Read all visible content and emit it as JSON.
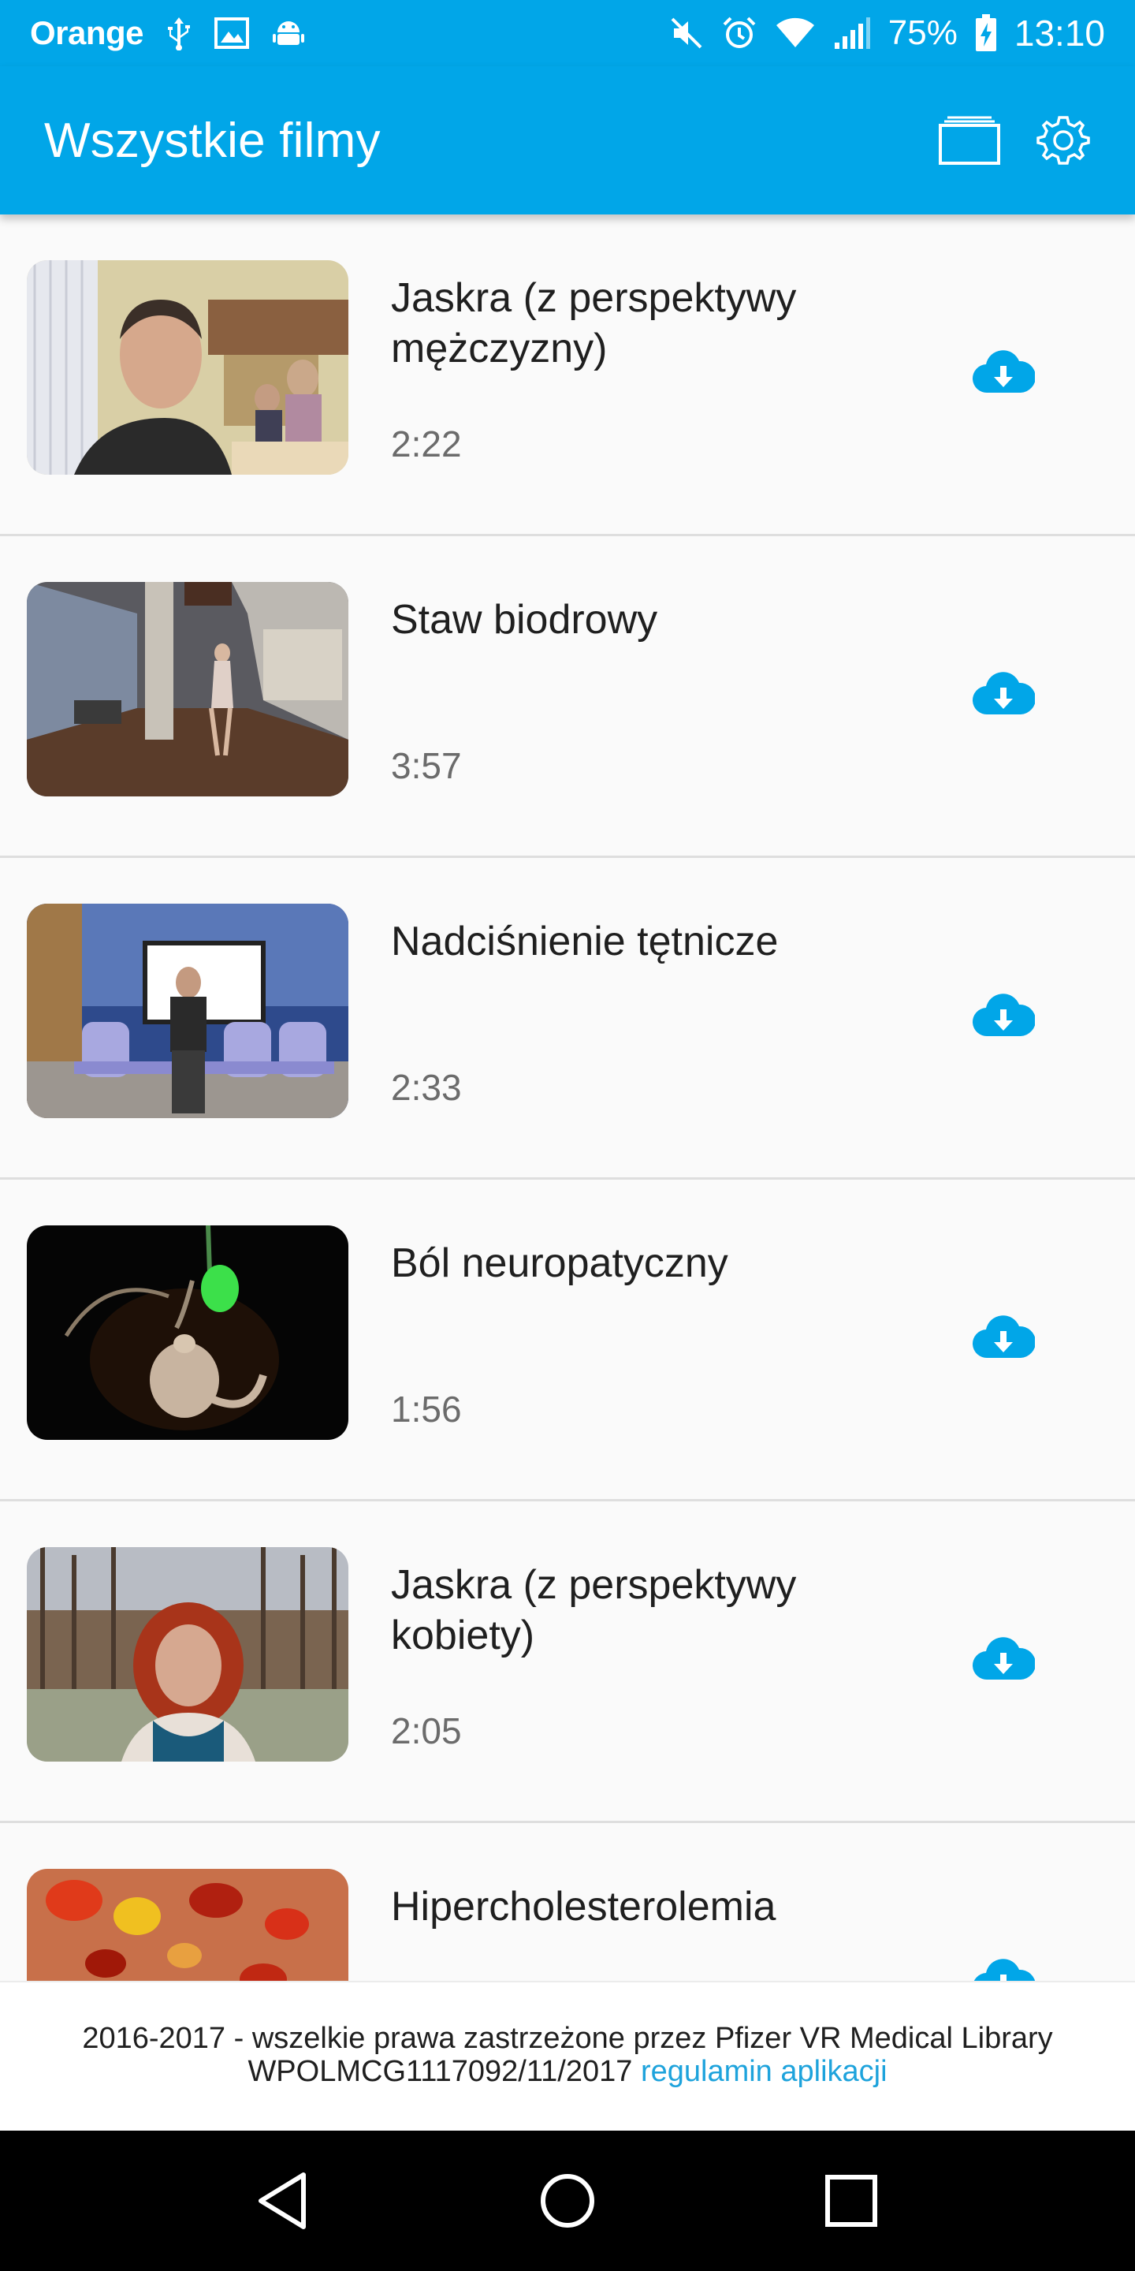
{
  "status_bar": {
    "carrier": "Orange",
    "battery": "75%",
    "time": "13:10",
    "icons": [
      "usb-icon",
      "image-icon",
      "android-icon",
      "mute-icon",
      "alarm-icon",
      "wifi-icon",
      "signal-icon",
      "battery-charging-icon"
    ]
  },
  "app_bar": {
    "title": "Wszystkie filmy",
    "actions": [
      "cardboard-viewer-icon",
      "settings-gear-icon"
    ]
  },
  "colors": {
    "primary": "#01a6e8",
    "link": "#1ea3dc",
    "download_icon": "#01a6e8"
  },
  "videos": [
    {
      "title": "Jaskra (z perspektywy mężczyzny)",
      "duration": "2:22",
      "thumbnail": "man-at-dinner-table",
      "action_icon": "cloud-download-icon"
    },
    {
      "title": "Staw biodrowy",
      "duration": "3:57",
      "thumbnail": "dancer-in-studio",
      "action_icon": "cloud-download-icon"
    },
    {
      "title": "Nadciśnienie tętnicze",
      "duration": "2:33",
      "thumbnail": "man-in-waiting-room",
      "action_icon": "cloud-download-icon"
    },
    {
      "title": "Ból neuropatyczny",
      "duration": "1:56",
      "thumbnail": "neuron-illustration",
      "action_icon": "cloud-download-icon"
    },
    {
      "title": "Jaskra (z perspektywy kobiety)",
      "duration": "2:05",
      "thumbnail": "woman-in-park",
      "action_icon": "cloud-download-icon"
    },
    {
      "title": "Hipercholesterolemia",
      "duration": "",
      "thumbnail": "blood-cells-illustration",
      "action_icon": "cloud-download-icon"
    }
  ],
  "footer": {
    "line1": "2016-2017 - wszelkie prawa zastrzeżone przez Pfizer VR Medical Library",
    "line2": "WPOLMCG1117092/11/2017",
    "link": "regulamin aplikacji"
  },
  "nav_bar": {
    "buttons": [
      "back-triangle-icon",
      "home-circle-icon",
      "recents-square-icon"
    ]
  }
}
